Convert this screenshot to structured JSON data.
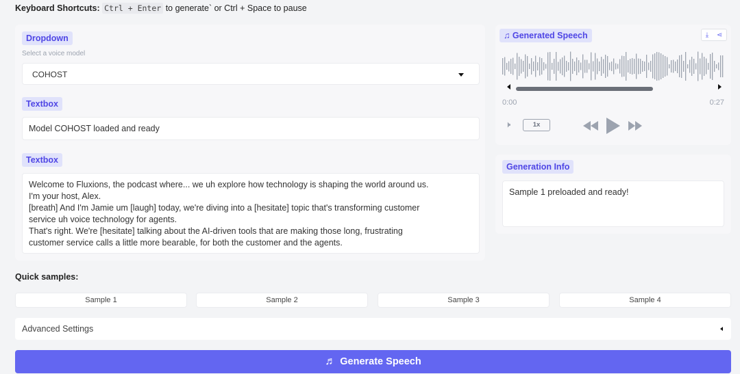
{
  "shortcuts": {
    "label": "Keyboard Shortcuts:",
    "key1": "Ctrl + Enter",
    "text1": "to generate",
    "text2": "or Ctrl + Space to pause"
  },
  "dropdown": {
    "tag": "Dropdown",
    "hint": "Select a voice model",
    "value": "COHOST"
  },
  "status_box": {
    "tag": "Textbox",
    "value": "Model COHOST loaded and ready"
  },
  "script_box": {
    "tag": "Textbox",
    "lines": [
      "Welcome to Fluxions, the podcast where... we uh explore how technology is shaping the world around us.",
      "I'm your host, Alex.",
      "[breath] And I'm Jamie um [laugh] today, we're diving into a [hesitate] topic that's transforming customer",
      "service uh voice technology for agents.",
      "That's right. We're [hesitate] talking about the AI-driven tools that are making those long, frustrating",
      "customer service calls a little more bearable, for both the customer and the agents."
    ]
  },
  "audio": {
    "tag": "Generated Speech",
    "current_time": "0:00",
    "duration": "0:27",
    "speed": "1x",
    "progress": 0
  },
  "info": {
    "tag": "Generation Info",
    "value": "Sample 1 preloaded and ready!"
  },
  "samples": {
    "title": "Quick samples:",
    "items": [
      "Sample 1",
      "Sample 2",
      "Sample 3",
      "Sample 4"
    ]
  },
  "advanced": {
    "label": "Advanced Settings"
  },
  "generate": {
    "label": "Generate Speech"
  },
  "colors": {
    "accent": "#6366f1",
    "tag_bg": "#e0e2fb"
  }
}
